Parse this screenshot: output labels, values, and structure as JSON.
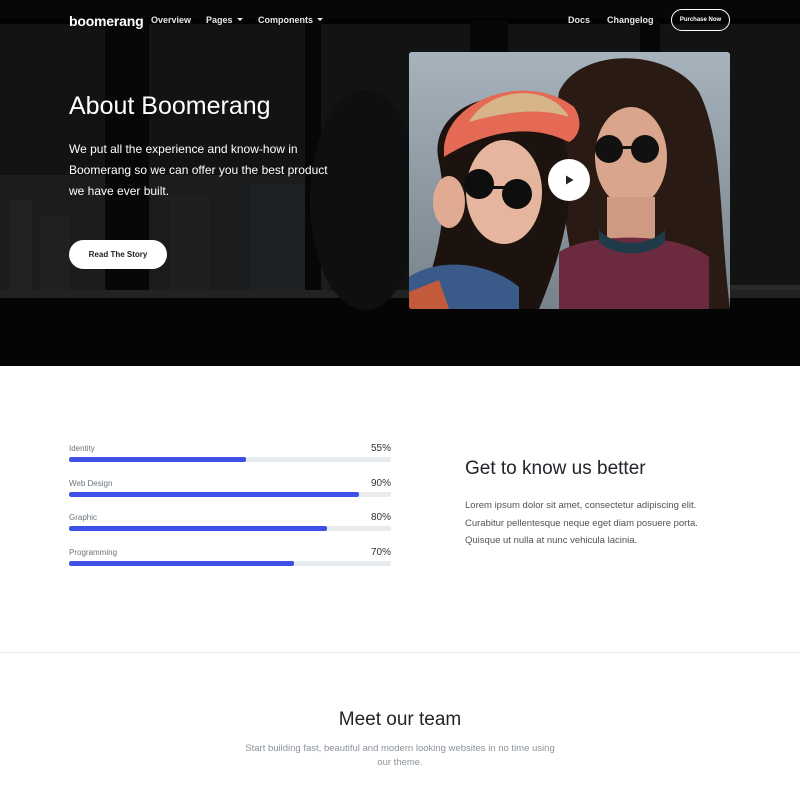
{
  "nav": {
    "brand": "boomerang",
    "links": [
      "Overview",
      "Pages",
      "Components"
    ],
    "right_links": [
      "Docs",
      "Changelog"
    ],
    "cta": "Purchase Now"
  },
  "hero": {
    "title": "About Boomerang",
    "text": "We put all the experience and know-how in Boomerang so we can offer you the best product we have ever built.",
    "button": "Read The Story",
    "media_icon": "play-icon"
  },
  "skills": [
    {
      "label": "Identity",
      "percent_text": "55%",
      "value": 0.55
    },
    {
      "label": "Web Design",
      "percent_text": "90%",
      "value": 0.9
    },
    {
      "label": "Graphic",
      "percent_text": "80%",
      "value": 0.8
    },
    {
      "label": "Programming",
      "percent_text": "70%",
      "value": 0.7
    }
  ],
  "about": {
    "title": "Get to know us better",
    "text": "Lorem ipsum dolor sit amet, consectetur adipiscing elit. Curabitur pellentesque neque eget diam posuere porta. Quisque ut nulla at nunc vehicula lacinia."
  },
  "team": {
    "title": "Meet our team",
    "subtitle": "Start building fast, beautiful and modern looking websites in no time using our theme."
  },
  "colors": {
    "accent": "#3d51e8",
    "hero_bg": "#050505",
    "track": "#e9ecef"
  }
}
